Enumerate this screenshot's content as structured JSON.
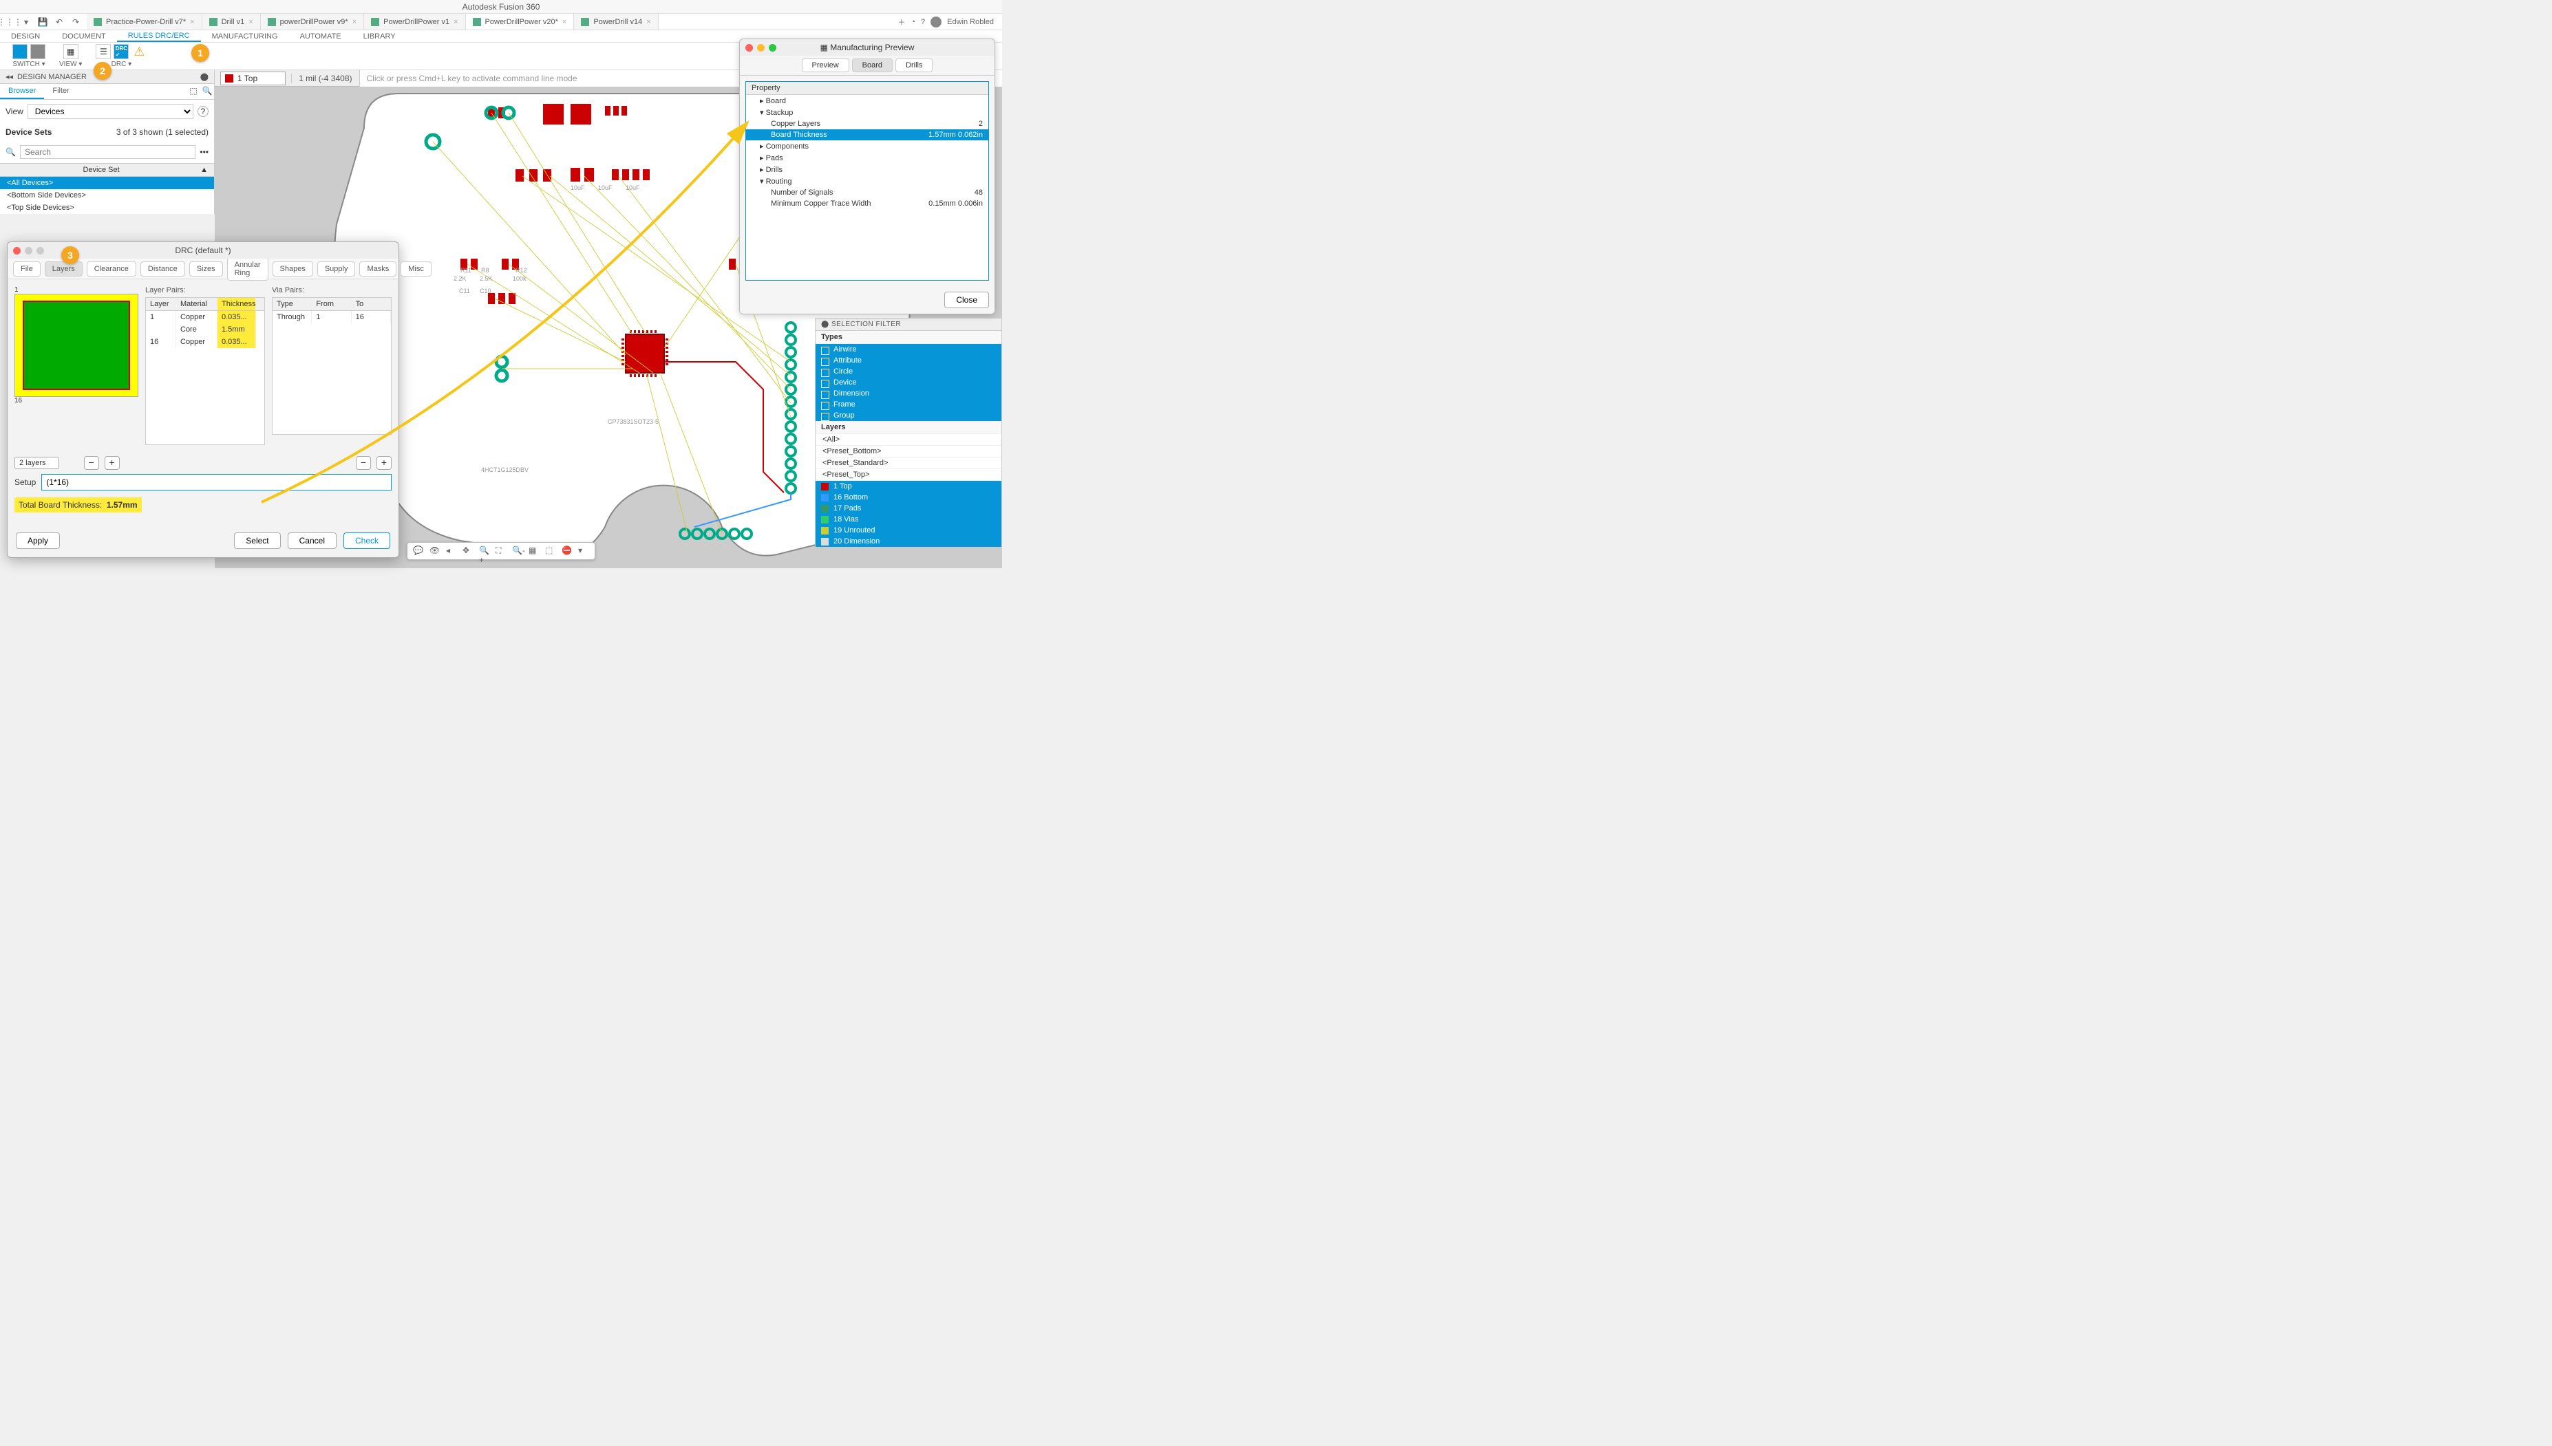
{
  "app_title": "Autodesk Fusion 360",
  "user_name": "Edwin Robled",
  "file_tabs": [
    {
      "label": "Practice-Power-Drill v7*",
      "active": false
    },
    {
      "label": "Drill v1",
      "active": false
    },
    {
      "label": "powerDrillPower v9*",
      "active": false
    },
    {
      "label": "PowerDrillPower v1",
      "active": false
    },
    {
      "label": "PowerDrillPower v20*",
      "active": true
    },
    {
      "label": "PowerDrill v14",
      "active": false
    }
  ],
  "workspace_tabs": [
    "DESIGN",
    "DOCUMENT",
    "RULES DRC/ERC",
    "MANUFACTURING",
    "AUTOMATE",
    "LIBRARY"
  ],
  "workspace_active": "RULES DRC/ERC",
  "ribbon_groups": [
    {
      "label": "SWITCH ▾"
    },
    {
      "label": "VIEW ▾"
    },
    {
      "label": "DRC ▾"
    }
  ],
  "callouts": {
    "c1": "1",
    "c2": "2",
    "c3": "3"
  },
  "design_manager": {
    "title": "DESIGN MANAGER",
    "tabs": [
      "Browser",
      "Filter"
    ],
    "tab_active": "Browser",
    "view_label": "View",
    "view_value": "Devices",
    "sets_label": "Device Sets",
    "sets_count": "3 of 3 shown (1 selected)",
    "search_placeholder": "Search",
    "list_header": "Device Set",
    "items": [
      "<All Devices>",
      "<Bottom Side Devices>",
      "<Top Side Devices>"
    ],
    "selected_index": 0
  },
  "canvas": {
    "layer": "1 Top",
    "coord": "1 mil (-4 3408)",
    "cmd_placeholder": "Click or press Cmd+L key to activate command line mode"
  },
  "drc": {
    "title": "DRC (default *)",
    "tabs": [
      "File",
      "Layers",
      "Clearance",
      "Distance",
      "Sizes",
      "Annular Ring",
      "Shapes",
      "Supply",
      "Masks",
      "Misc"
    ],
    "tab_active": "Layers",
    "layer_pairs_label": "Layer Pairs:",
    "via_pairs_label": "Via Pairs:",
    "layers_cols": [
      "Layer",
      "Material",
      "Thickness"
    ],
    "layers_rows": [
      {
        "layer": "1",
        "material": "Copper",
        "thickness": "0.035..."
      },
      {
        "layer": "",
        "material": "Core",
        "thickness": "1.5mm"
      },
      {
        "layer": "16",
        "material": "Copper",
        "thickness": "0.035..."
      }
    ],
    "via_cols": [
      "Type",
      "From",
      "To"
    ],
    "via_rows": [
      {
        "type": "Through",
        "from": "1",
        "to": "16"
      }
    ],
    "preview_top": "1",
    "preview_bot": "16",
    "layer_count_value": "2 layers",
    "setup_label": "Setup",
    "setup_value": "(1*16)",
    "total_label": "Total Board Thickness:",
    "total_value": "1.57mm",
    "buttons": {
      "apply": "Apply",
      "select": "Select",
      "cancel": "Cancel",
      "check": "Check"
    }
  },
  "mfg": {
    "title": "Manufacturing Preview",
    "tabs": [
      "Preview",
      "Board",
      "Drills"
    ],
    "tab_active": "Board",
    "header": "Property",
    "tree": [
      {
        "k": "Board",
        "lvl": 1,
        "exp": "▸"
      },
      {
        "k": "Stackup",
        "lvl": 1,
        "exp": "▾"
      },
      {
        "k": "Copper Layers",
        "v": "2",
        "lvl": 2
      },
      {
        "k": "Board Thickness",
        "v": "1.57mm   0.062in",
        "lvl": 2,
        "sel": true
      },
      {
        "k": "Components",
        "lvl": 1,
        "exp": "▸"
      },
      {
        "k": "Pads",
        "lvl": 1,
        "exp": "▸"
      },
      {
        "k": "Drills",
        "lvl": 1,
        "exp": "▸"
      },
      {
        "k": "Routing",
        "lvl": 1,
        "exp": "▾"
      },
      {
        "k": "Number of Signals",
        "v": "48",
        "lvl": 2
      },
      {
        "k": "Minimum Copper Trace Width",
        "v": "0.15mm   0.006in",
        "lvl": 2
      }
    ],
    "close": "Close"
  },
  "selection_filter": {
    "header": "SELECTION FILTER",
    "types_label": "Types",
    "types": [
      "Airwire",
      "Attribute",
      "Circle",
      "Device",
      "Dimension",
      "Frame",
      "Group"
    ],
    "layers_label": "Layers",
    "presets": [
      "<All>",
      "<Preset_Bottom>",
      "<Preset_Standard>",
      "<Preset_Top>"
    ],
    "layers": [
      {
        "name": "1 Top",
        "color": "#cc0000"
      },
      {
        "name": "16 Bottom",
        "color": "#3399ff"
      },
      {
        "name": "17 Pads",
        "color": "#339966"
      },
      {
        "name": "18 Vias",
        "color": "#33cc66"
      },
      {
        "name": "19 Unrouted",
        "color": "#cccc33"
      },
      {
        "name": "20 Dimension",
        "color": "#dddddd"
      }
    ]
  }
}
